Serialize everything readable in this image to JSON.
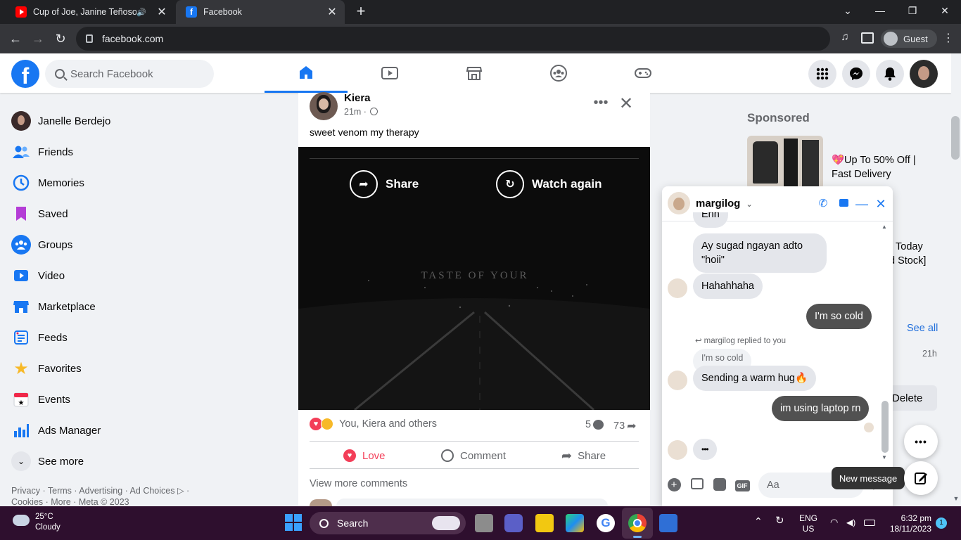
{
  "browser": {
    "tabs": [
      {
        "title": "Cup of Joe, Janine Teñoso -"
      },
      {
        "title": "Facebook"
      }
    ],
    "url": "facebook.com",
    "profile": "Guest"
  },
  "fb_header": {
    "logo": "f",
    "search_placeholder": "Search Facebook"
  },
  "sidebar": {
    "items": [
      {
        "label": "Janelle Berdejo",
        "icon": "avatar"
      },
      {
        "label": "Friends",
        "icon": "friends-icon"
      },
      {
        "label": "Memories",
        "icon": "clock-icon"
      },
      {
        "label": "Saved",
        "icon": "bookmark-icon"
      },
      {
        "label": "Groups",
        "icon": "groups-icon"
      },
      {
        "label": "Video",
        "icon": "video-icon"
      },
      {
        "label": "Marketplace",
        "icon": "shop-icon"
      },
      {
        "label": "Feeds",
        "icon": "feeds-icon"
      },
      {
        "label": "Favorites",
        "icon": "star-icon"
      },
      {
        "label": "Events",
        "icon": "calendar-icon"
      },
      {
        "label": "Ads Manager",
        "icon": "chart-icon"
      },
      {
        "label": "See more",
        "icon": "chevron-down-icon"
      }
    ],
    "footer_line1": "Privacy · Terms · Advertising · Ad Choices ▷ ·",
    "footer_line2": "Cookies · More · Meta © 2023"
  },
  "post": {
    "author": "Kiera",
    "time": "21m ·",
    "text": "sweet venom my therapy",
    "video_share_label": "Share",
    "video_watch_again_label": "Watch again",
    "video_title": "TASTE OF YOUR",
    "reactions_text": "You, Kiera and others",
    "comments_count": "5",
    "shares_count": "73",
    "love_label": "Love",
    "comment_label": "Comment",
    "share_label": "Share",
    "view_more_comments": "View more comments"
  },
  "right_column": {
    "sponsored_label": "Sponsored",
    "ad_text_line1": "💖Up To 50% Off |",
    "ad_text_line2": "Fast Delivery",
    "ad2_line1": "Today",
    "ad2_line2": "d Stock]",
    "see_all": "See all",
    "time_21h": "21h",
    "delete_label": "Delete"
  },
  "chat": {
    "name": "margilog",
    "messages": [
      {
        "dir": "in",
        "text": "Ehh"
      },
      {
        "dir": "in",
        "text": "Ay sugad ngayan adto \"hoii\""
      },
      {
        "dir": "in",
        "text": "Hahahhaha"
      },
      {
        "dir": "out",
        "text": "I'm so cold"
      },
      {
        "dir": "meta",
        "text": "margilog replied to you"
      },
      {
        "dir": "quote",
        "text": "I'm so cold"
      },
      {
        "dir": "in",
        "text": "Sending a warm hug🔥"
      },
      {
        "dir": "out",
        "text": "im using laptop rn"
      },
      {
        "dir": "in",
        "text": "•••"
      }
    ],
    "input_placeholder": "Aa",
    "new_message_tooltip": "New message",
    "gif_label": "GIF"
  },
  "taskbar": {
    "temperature": "25°C",
    "condition": "Cloudy",
    "search_label": "Search",
    "lang1": "ENG",
    "lang2": "US",
    "time": "6:32 pm",
    "date": "18/11/2023",
    "notification_count": "1"
  },
  "colors": {
    "fb_blue": "#1877f2",
    "love_red": "#f33e58",
    "taskbar": "#2e0f2e",
    "out_bubble": "#515151"
  }
}
